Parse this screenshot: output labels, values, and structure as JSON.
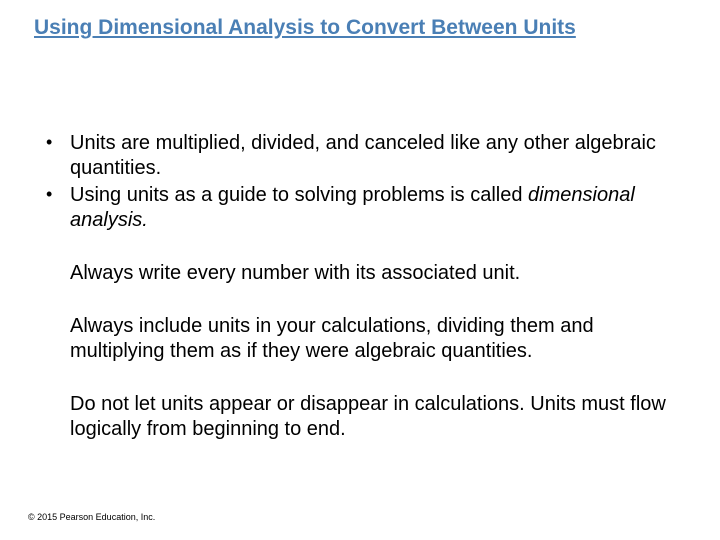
{
  "title": "Using Dimensional Analysis to Convert Between Units",
  "bullets": [
    {
      "pre": "Units are multiplied, divided, and canceled like any other algebraic quantities."
    },
    {
      "pre": "Using units as a guide to solving problems is called ",
      "italic": "dimensional analysis."
    }
  ],
  "paras": [
    "Always write every number with its associated unit.",
    "Always include units in your calculations, dividing them and multiplying them as if they were algebraic quantities.",
    "Do not let units appear or disappear in calculations. Units must flow logically from beginning to end."
  ],
  "copyright": "© 2015 Pearson Education, Inc."
}
